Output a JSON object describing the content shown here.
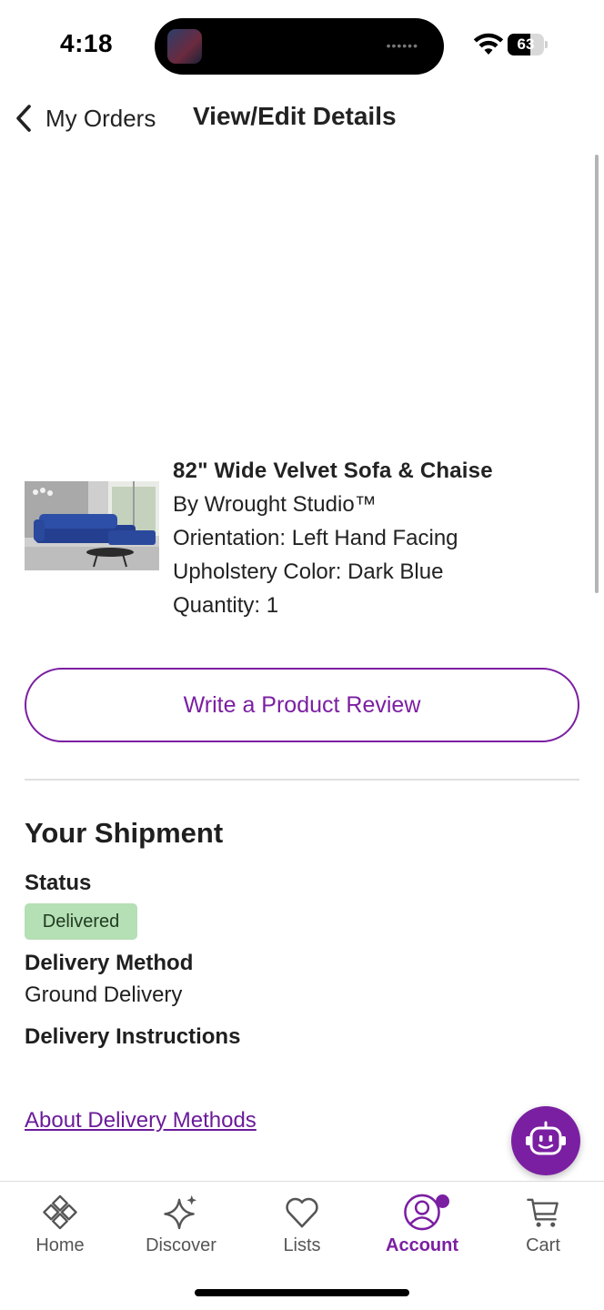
{
  "status_bar": {
    "time": "4:18",
    "battery": "63",
    "battery_level": 0.63,
    "island_dots": "••••••"
  },
  "nav": {
    "back_label": "My Orders",
    "title": "View/Edit Details"
  },
  "product": {
    "name": "82\" Wide Velvet Sofa & Chaise",
    "brand": "By Wrought Studio™",
    "orientation": "Orientation: Left Hand Facing",
    "color": "Upholstery Color: Dark Blue",
    "quantity": "Quantity: 1",
    "review_button": "Write a Product Review"
  },
  "shipment": {
    "title": "Your Shipment",
    "status_label": "Status",
    "status_value": "Delivered",
    "method_label": "Delivery Method",
    "method_value": "Ground Delivery",
    "instructions_label": "Delivery Instructions",
    "about_link": "About Delivery Methods"
  },
  "tabs": [
    {
      "label": "Home",
      "icon": "home-icon"
    },
    {
      "label": "Discover",
      "icon": "sparkle-icon"
    },
    {
      "label": "Lists",
      "icon": "heart-icon"
    },
    {
      "label": "Account",
      "icon": "account-icon",
      "active": true
    },
    {
      "label": "Cart",
      "icon": "cart-icon"
    }
  ],
  "colors": {
    "accent": "#7b1fa2",
    "status_badge": "#b5dfb5"
  }
}
